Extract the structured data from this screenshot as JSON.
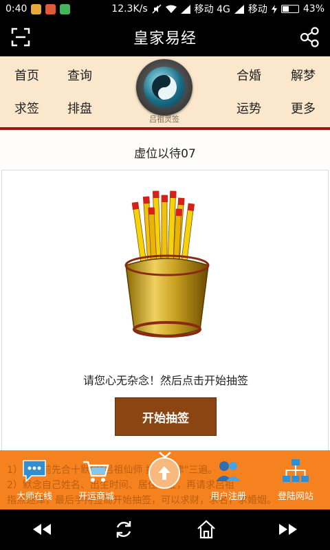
{
  "status": {
    "time": "0:40",
    "speed": "12.3K/s",
    "carrier1": "移动 4G",
    "carrier2": "移动",
    "battery": "43%"
  },
  "app": {
    "title": "皇家易经"
  },
  "nav": {
    "items": [
      "首页",
      "查询",
      "合婚",
      "解梦",
      "求签",
      "排盘",
      "运势",
      "更多"
    ],
    "logo_caption": "吕祖灵签"
  },
  "content": {
    "header": "虚位以待07",
    "instruction": "请您心无杂念！然后点击开始抽签",
    "button": "开始抽签"
  },
  "bottom": {
    "faded_line1": "1）抽签前先合十默念\"吕祖仙师 指点迷津\"三遍。",
    "faded_line2": "2）默念自己姓名、出生时间、居住地址，再请求吕祖",
    "faded_line3": "指点迷津，最后手持签筒开始抽签，可以求财，求名，求婚姻。",
    "items": [
      "大师在线",
      "开运商城",
      "用户注册",
      "登陆网站"
    ]
  },
  "colors": {
    "nav_bg": "#fbe7cb",
    "accent_line": "#9a1a12",
    "button_bg": "#8b4513",
    "bottom_bar": "#f5821f"
  }
}
